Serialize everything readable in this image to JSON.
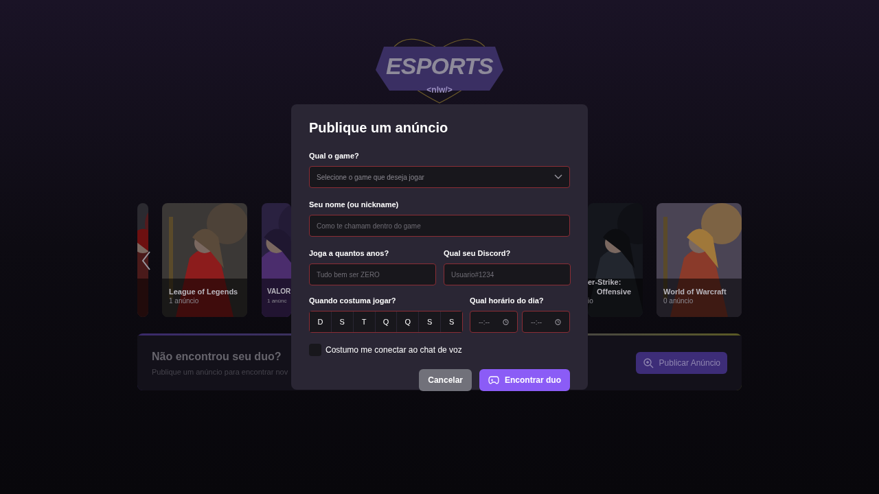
{
  "logo": {
    "title": "ESPORTS",
    "subtitle": "<nlw/>"
  },
  "carousel": {
    "games": [
      {
        "kind": "sliver"
      },
      {
        "kind": "full",
        "title": "League of Legends",
        "ads": "1 anúncio"
      },
      {
        "kind": "left-part",
        "title": "VALOR",
        "ads": "1 anúnc"
      },
      {
        "kind": "right-part",
        "title_lines": [
          "er-Strike:",
          "Offensive"
        ],
        "ads": "io"
      },
      {
        "kind": "full",
        "title": "World of Warcraft",
        "ads": "0 anúncio"
      }
    ]
  },
  "banner": {
    "title": "Não encontrou seu duo?",
    "subtitle": "Publique um anúncio para encontrar nov",
    "button": "Publicar Anúncio"
  },
  "modal": {
    "title": "Publique um anúncio",
    "game": {
      "label": "Qual o game?",
      "placeholder": "Selecione o game que deseja jogar"
    },
    "name": {
      "label": "Seu nome (ou nickname)",
      "placeholder": "Como te chamam dentro do game"
    },
    "years": {
      "label": "Joga a quantos anos?",
      "placeholder": "Tudo bem ser ZERO"
    },
    "discord": {
      "label": "Qual seu Discord?",
      "placeholder": "Usuario#1234"
    },
    "days_label": "Quando costuma jogar?",
    "days": [
      {
        "label": "D",
        "selected": false
      },
      {
        "label": "S",
        "selected": false
      },
      {
        "label": "T",
        "selected": false
      },
      {
        "label": "Q",
        "selected": false
      },
      {
        "label": "Q",
        "selected": false
      },
      {
        "label": "S",
        "selected": false
      },
      {
        "label": "S",
        "selected": false
      }
    ],
    "hours_label": "Qual horário do dia?",
    "hours": [
      {
        "placeholder": "--:--"
      },
      {
        "placeholder": "--:--"
      }
    ],
    "voice": {
      "label": "Costumo me conectar ao chat de voz",
      "checked": false
    },
    "cancel": "Cancelar",
    "submit": "Encontrar duo"
  }
}
